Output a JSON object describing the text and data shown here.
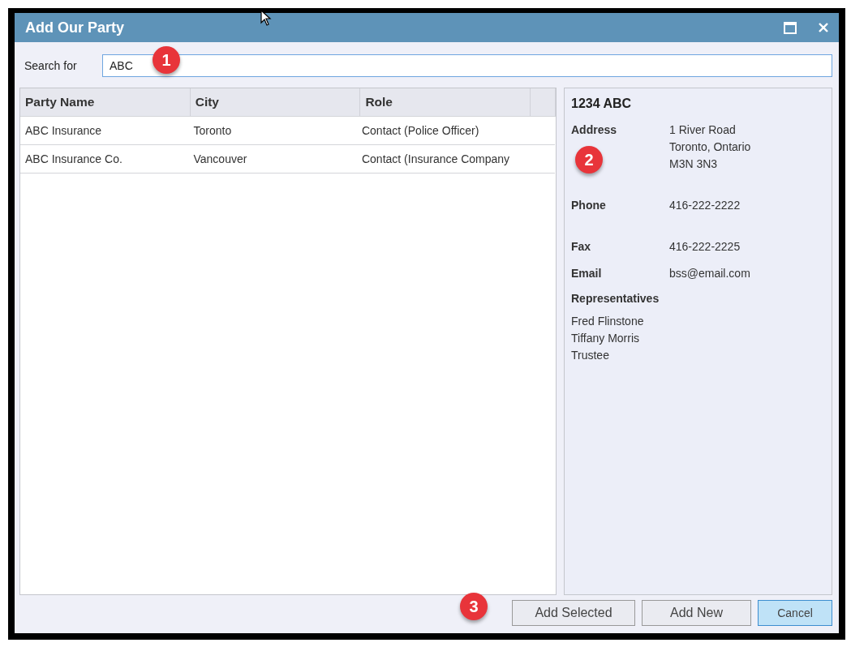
{
  "window": {
    "title": "Add Our Party"
  },
  "search": {
    "label": "Search for",
    "value": "ABC"
  },
  "table": {
    "columns": [
      "Party Name",
      "City",
      "Role"
    ],
    "rows": [
      {
        "cells": [
          "ABC Insurance",
          "Toronto",
          "Contact (Police Officer)"
        ]
      },
      {
        "cells": [
          "ABC Insurance Co.",
          "Vancouver",
          "Contact (Insurance Company"
        ]
      }
    ]
  },
  "details": {
    "title": "1234 ABC",
    "fields": [
      {
        "label": "Address",
        "lines": [
          "1 River Road",
          "Toronto, Ontario",
          "M3N 3N3"
        ]
      },
      {
        "label": "Phone",
        "lines": [
          "416-222-2222"
        ]
      },
      {
        "label": "Fax",
        "lines": [
          "416-222-2225"
        ]
      },
      {
        "label": "Email",
        "lines": [
          "bss@email.com"
        ]
      }
    ],
    "representatives_label": "Representatives",
    "representatives": [
      "Fred Flinstone",
      "Tiffany Morris",
      "Trustee"
    ]
  },
  "buttons": [
    {
      "label": "Add Selected",
      "default": false
    },
    {
      "label": "Add New",
      "default": false
    },
    {
      "label": "Cancel",
      "default": true
    }
  ],
  "callouts": [
    "1",
    "2",
    "3"
  ]
}
